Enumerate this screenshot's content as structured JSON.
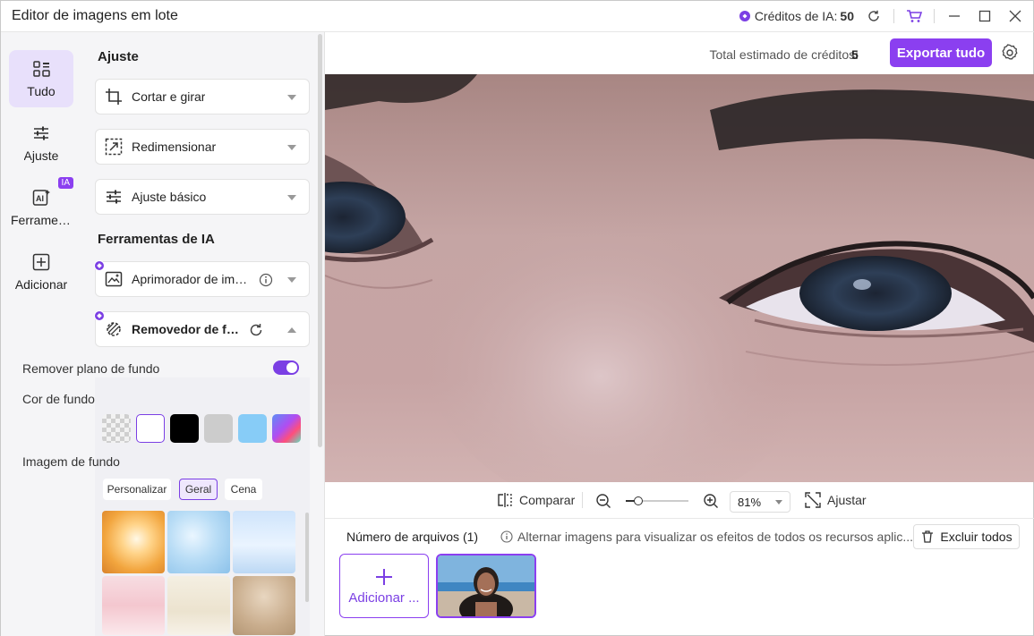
{
  "window": {
    "title": "Editor de imagens em lote"
  },
  "titlebar": {
    "credits_label": "Créditos de IA:",
    "credits_value": "50"
  },
  "rail": {
    "items": [
      {
        "label": "Tudo",
        "icon": "grid-icon"
      },
      {
        "label": "Ajuste",
        "icon": "sliders-icon"
      },
      {
        "label": "Ferramentas de IA",
        "icon": "ai-icon",
        "badge": "IA"
      },
      {
        "label": "Adicionar",
        "icon": "plus-square-icon"
      }
    ]
  },
  "panel": {
    "adjust_title": "Ajuste",
    "adjust_items": [
      "Cortar e girar",
      "Redimensionar",
      "Ajuste básico"
    ],
    "ai_title": "Ferramentas de IA",
    "ai_items": [
      "Aprimorador de imagem",
      "Removedor de fundo"
    ],
    "remove_bg_label": "Remover plano de fundo",
    "remove_bg_on": true,
    "bg_color_label": "Cor de fundo",
    "bg_colors": [
      "transparent",
      "#ffffff",
      "#000000",
      "#cccccc",
      "#87ccf7",
      "gradient"
    ],
    "bg_image_label": "Imagem de fundo",
    "bg_tabs": [
      "Personalizar",
      "Geral",
      "Cena"
    ],
    "bg_tab_selected": "Geral"
  },
  "main": {
    "est_label": "Total estimado de créditos:",
    "est_value": "5",
    "export_label": "Exportar tudo",
    "compare_label": "Comparar",
    "zoom_value": "81%",
    "zoom_level": 0.15,
    "fit_label": "Ajustar",
    "file_count": "Número de arquivos (1)",
    "hint": "Alternar imagens para visualizar os efeitos de todos os recursos aplic...",
    "delete_all": "Excluir todos",
    "add_label": "Adicionar ..."
  },
  "colors": {
    "accent": "#8b3ff0",
    "accent_light": "#e8e0fb"
  }
}
